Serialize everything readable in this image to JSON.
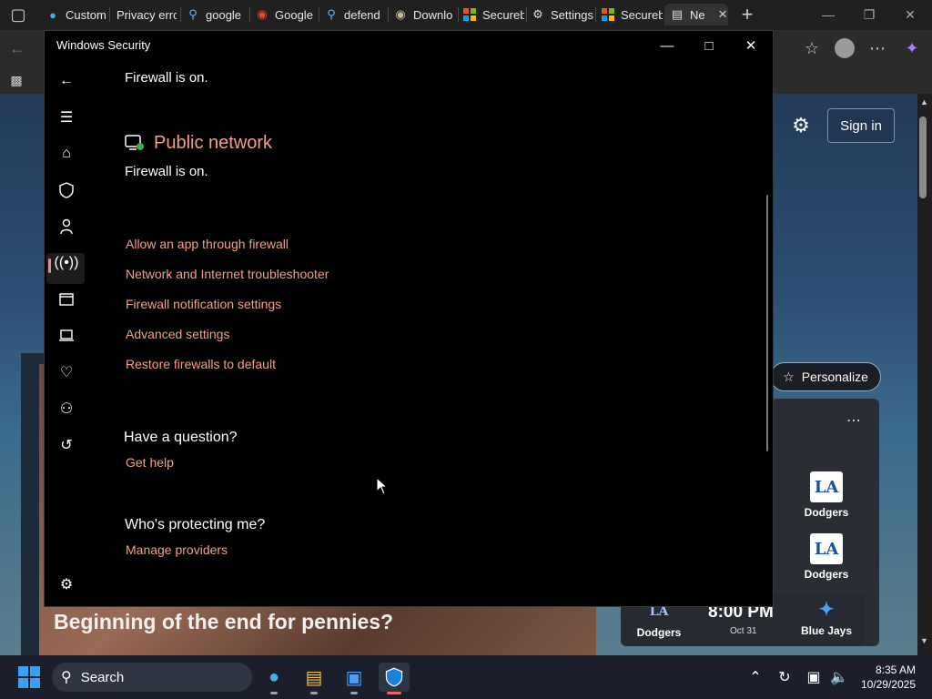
{
  "browser": {
    "tabs": [
      {
        "icon": "edge-icon",
        "label": "Custom"
      },
      {
        "icon": "none",
        "label": "Privacy error"
      },
      {
        "icon": "search-icon",
        "label": "google"
      },
      {
        "icon": "maps-pin-icon",
        "label": "Google"
      },
      {
        "icon": "search-icon",
        "label": "defend"
      },
      {
        "icon": "download-icon",
        "label": "Downlo"
      },
      {
        "icon": "microsoft-icon",
        "label": "Secureb"
      },
      {
        "icon": "gear-icon",
        "label": "Settings"
      },
      {
        "icon": "microsoft-icon",
        "label": "Secureb"
      },
      {
        "icon": "newtab-icon",
        "label": "Ne"
      }
    ]
  },
  "page": {
    "signin": "Sign in",
    "personalize": "Personalize",
    "news_headline": "Beginning of the end for pennies?",
    "teams": [
      "Dodgers",
      "Dodgers",
      "Dodgers",
      "Blue Jays"
    ],
    "game_time": "8:00 PM",
    "game_date": "Oct 31"
  },
  "security": {
    "window_title": "Windows Security",
    "firewall_status_1": "Firewall is on.",
    "public_network_heading": "Public network",
    "firewall_status_2": "Firewall is on.",
    "links": [
      "Allow an app through firewall",
      "Network and Internet troubleshooter",
      "Firewall notification settings",
      "Advanced settings",
      "Restore firewalls to default"
    ],
    "question_heading": "Have a question?",
    "get_help": "Get help",
    "protecting_heading": "Who's protecting me?",
    "manage_providers": "Manage providers",
    "accent_color": "#f0a08a"
  },
  "taskbar": {
    "search_placeholder": "Search",
    "time": "8:35 AM",
    "date": "10/29/2025"
  }
}
